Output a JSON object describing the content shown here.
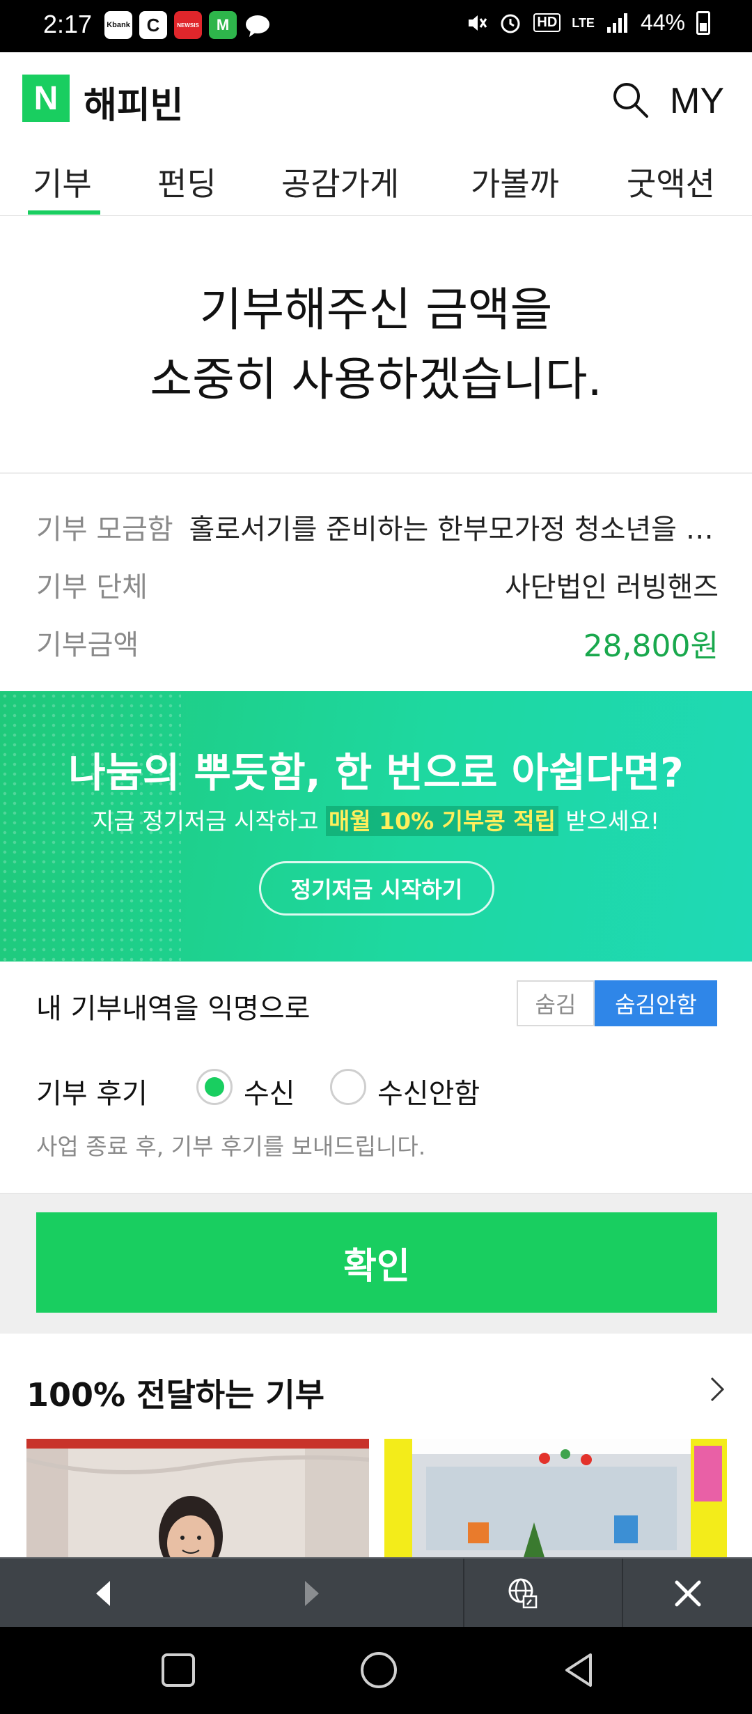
{
  "status_bar": {
    "time": "2:17",
    "apps": [
      "Kbank",
      "C",
      "NEWSIS",
      "M",
      "chat"
    ],
    "lte": "LTE",
    "hd": "HD",
    "battery": "44%"
  },
  "header": {
    "logo_letter": "N",
    "brand": "해피빈",
    "my_label": "MY"
  },
  "tabs": [
    {
      "label": "기부",
      "active": true
    },
    {
      "label": "펀딩",
      "active": false
    },
    {
      "label": "공감가게",
      "active": false
    },
    {
      "label": "가볼까",
      "active": false
    },
    {
      "label": "굿액션",
      "active": false
    }
  ],
  "thanks": {
    "line1": "기부해주신 금액을",
    "line2": "소중히 사용하겠습니다."
  },
  "info": {
    "fund_label": "기부 모금함",
    "fund_value": "홀로서기를 준비하는 한부모가정 청소년을 …",
    "org_label": "기부 단체",
    "org_value": "사단법인 러빙핸즈",
    "amount_label": "기부금액",
    "amount_value": "28,800원"
  },
  "banner": {
    "title": "나눔의 뿌듯함, 한 번으로 아쉽다면?",
    "sub_before": "지금 정기저금 시작하고 ",
    "sub_highlight": "매월 10% 기부콩 적립",
    "sub_after": " 받으세요!",
    "button": "정기저금 시작하기"
  },
  "anonymous": {
    "label": "내 기부내역을 익명으로",
    "hide": "숨김",
    "show": "숨김안함"
  },
  "review": {
    "label": "기부 후기",
    "option_receive": "수신",
    "option_decline": "수신안함",
    "note": "사업 종료 후, 기부 후기를 보내드립니다."
  },
  "confirm_label": "확인",
  "section": {
    "title": "100% 전달하는 기부"
  },
  "colors": {
    "brand_green": "#19ce60",
    "amount_green": "#19a84d",
    "toggle_blue": "#2f86e8"
  }
}
